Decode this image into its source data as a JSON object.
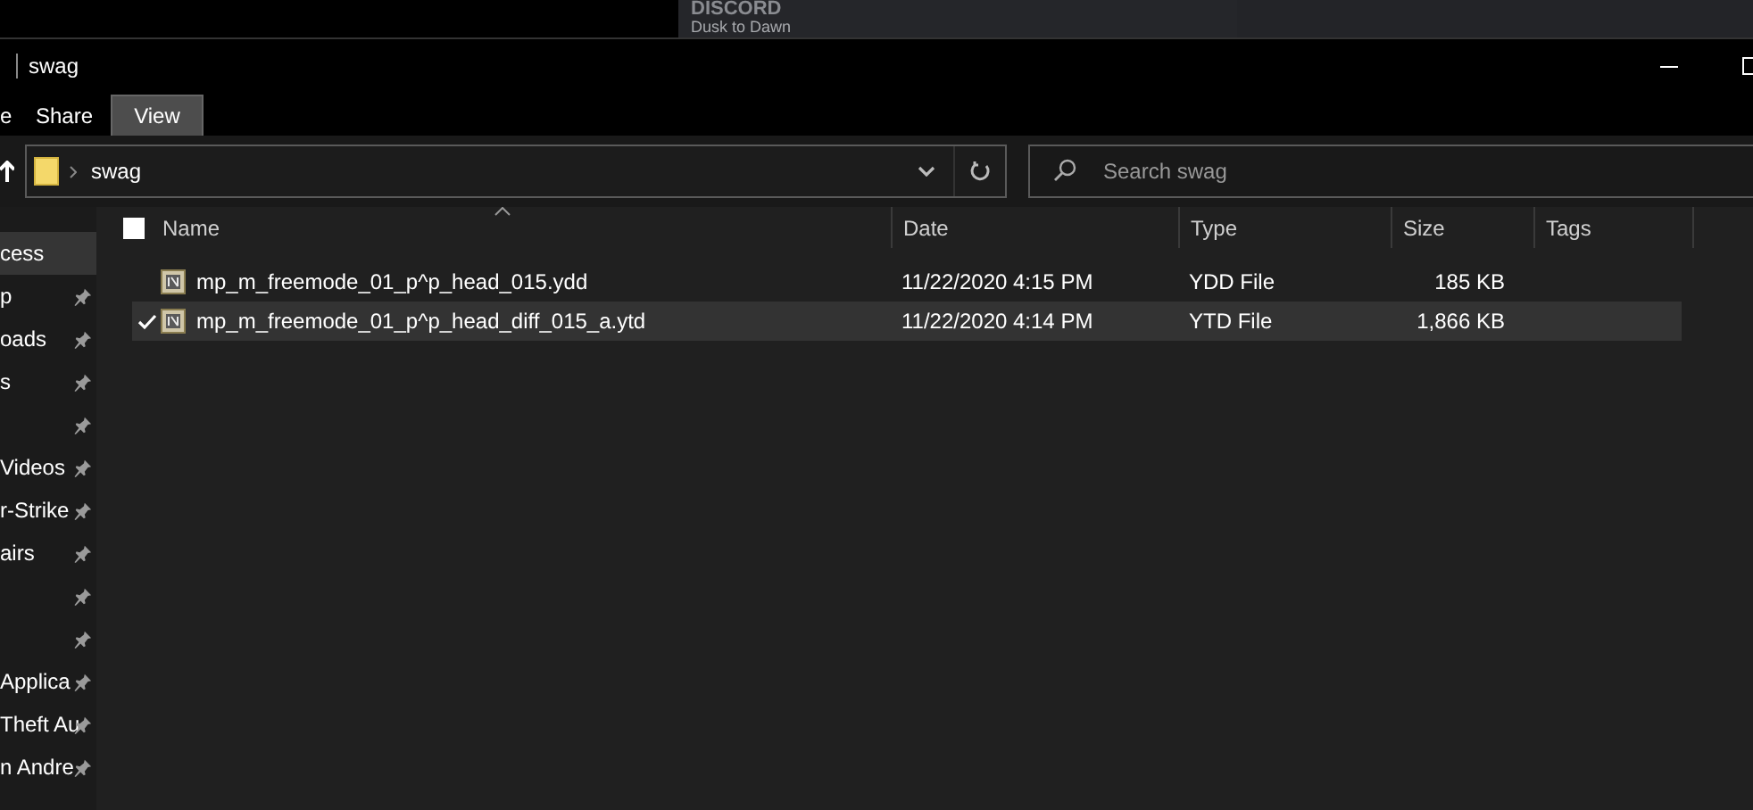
{
  "overlay": {
    "brand": "DISCORD",
    "subtitle": "Dusk to Dawn"
  },
  "window": {
    "title": "swag"
  },
  "tabs": [
    {
      "label": "e",
      "selected": false
    },
    {
      "label": "Share",
      "selected": false
    },
    {
      "label": "View",
      "selected": true
    }
  ],
  "address": {
    "path": "swag"
  },
  "search": {
    "placeholder": "Search swag"
  },
  "sidebar": {
    "items": [
      {
        "label": "cess",
        "selected": true,
        "pinned": false
      },
      {
        "label": "p",
        "selected": false,
        "pinned": true
      },
      {
        "label": "oads",
        "selected": false,
        "pinned": true
      },
      {
        "label": "s",
        "selected": false,
        "pinned": true
      },
      {
        "selected": false,
        "pinned": true
      },
      {
        "label": "Videos",
        "selected": false,
        "pinned": true
      },
      {
        "label": "r-Strike",
        "selected": false,
        "pinned": true
      },
      {
        "label": "airs",
        "selected": false,
        "pinned": true
      },
      {
        "selected": false,
        "pinned": true
      },
      {
        "selected": false,
        "pinned": true
      },
      {
        "label": "Applica",
        "selected": false,
        "pinned": true
      },
      {
        "label": "Theft Au",
        "selected": false,
        "pinned": true
      },
      {
        "label": "n Andre",
        "selected": false,
        "pinned": true
      }
    ]
  },
  "table": {
    "select_all": {
      "checked": false
    },
    "columns": [
      "Name",
      "Date",
      "Type",
      "Size",
      "Tags"
    ],
    "rows": [
      {
        "name": "mp_m_freemode_01_p^p_head_015.ydd",
        "date": "11/22/2020 4:15 PM",
        "type": "YDD File",
        "size": "185 KB",
        "selected": false
      },
      {
        "name": "mp_m_freemode_01_p^p_head_diff_015_a.ytd",
        "date": "11/22/2020 4:14 PM",
        "type": "YTD File",
        "size": "1,866 KB",
        "selected": true
      }
    ]
  }
}
